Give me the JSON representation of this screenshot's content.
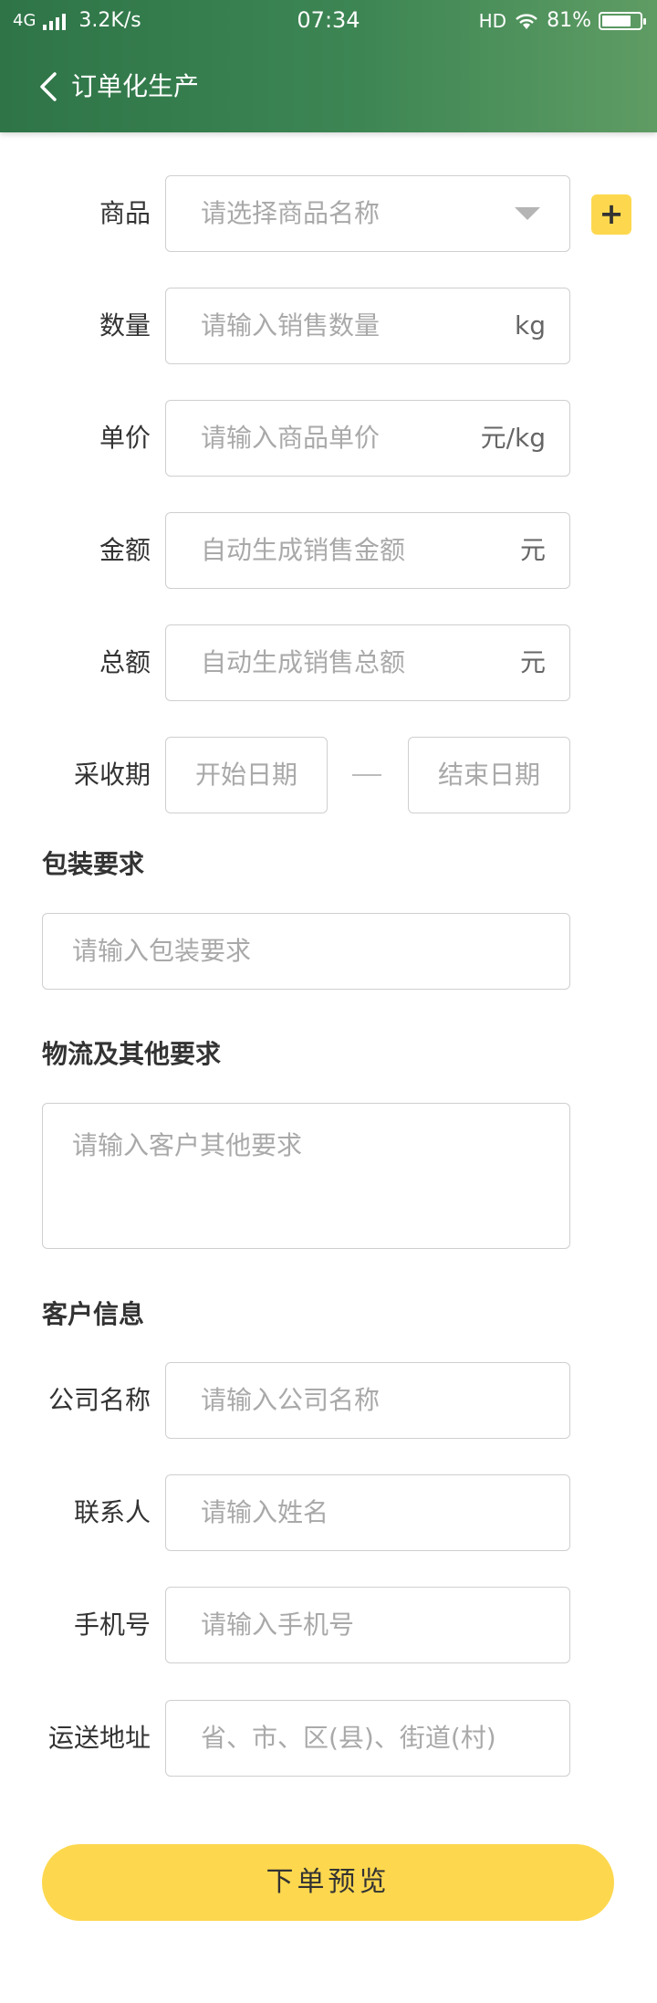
{
  "status_bar": {
    "network": "4G",
    "speed": "3.2K/s",
    "time": "07:34",
    "hd": "HD",
    "battery": "81%"
  },
  "header": {
    "title": "订单化生产"
  },
  "form": {
    "product": {
      "label": "商品",
      "placeholder": "请选择商品名称",
      "add_label": "+"
    },
    "quantity": {
      "label": "数量",
      "placeholder": "请输入销售数量",
      "unit": "kg"
    },
    "unit_price": {
      "label": "单价",
      "placeholder": "请输入商品单价",
      "unit": "元/kg"
    },
    "amount": {
      "label": "金额",
      "placeholder": "自动生成销售金额",
      "unit": "元"
    },
    "total": {
      "label": "总额",
      "placeholder": "自动生成销售总额",
      "unit": "元"
    },
    "harvest": {
      "label": "采收期",
      "start_placeholder": "开始日期",
      "end_placeholder": "结束日期"
    },
    "packaging": {
      "title": "包装要求",
      "placeholder": "请输入包装要求"
    },
    "logistics": {
      "title": "物流及其他要求",
      "placeholder": "请输入客户其他要求"
    },
    "customer": {
      "title": "客户信息",
      "company": {
        "label": "公司名称",
        "placeholder": "请输入公司名称"
      },
      "contact": {
        "label": "联系人",
        "placeholder": "请输入姓名"
      },
      "phone": {
        "label": "手机号",
        "placeholder": "请输入手机号"
      },
      "address": {
        "label": "运送地址",
        "placeholder": "省、市、区(县)、街道(村)"
      }
    }
  },
  "submit_label": "下单预览",
  "colors": {
    "header_start": "#2e7447",
    "header_end": "#5f9c64",
    "accent": "#fdd84e"
  }
}
